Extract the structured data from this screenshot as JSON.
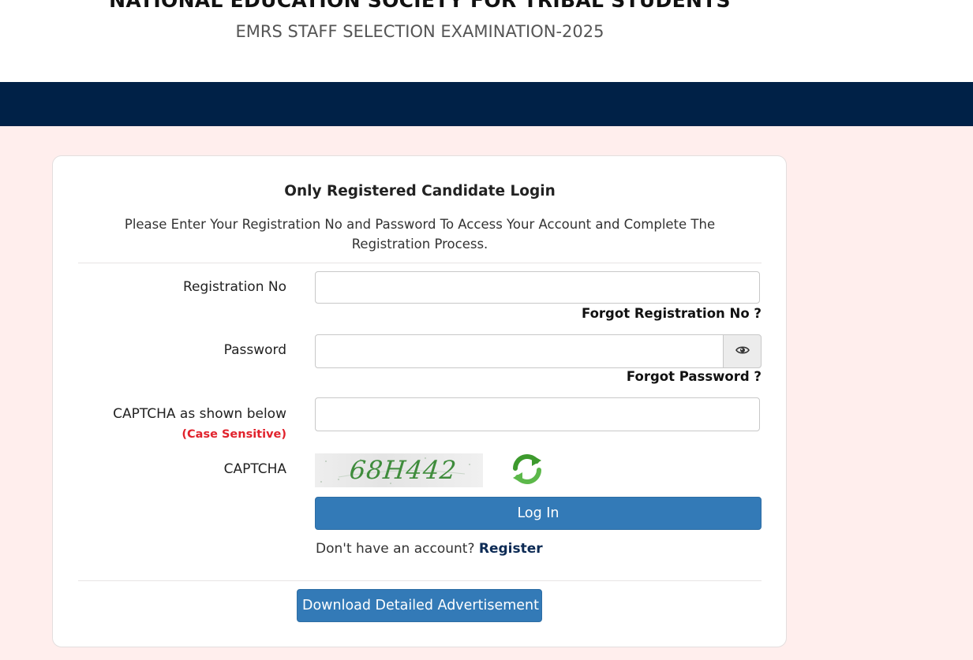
{
  "header": {
    "org_name": "NATIONAL EDUCATION SOCIETY FOR TRIBAL STUDENTS",
    "exam_name": "EMRS STAFF SELECTION EXAMINATION-2025"
  },
  "login": {
    "title": "Only Registered Candidate Login",
    "description": "Please Enter Your Registration No and Password To Access Your Account and Complete The Registration Process.",
    "registration_label": "Registration No",
    "registration_value": "",
    "forgot_registration": "Forgot Registration No ?",
    "password_label": "Password",
    "password_value": "",
    "forgot_password": "Forgot Password ?",
    "captcha_input_label": "CAPTCHA as shown below",
    "captcha_case_note": "(Case Sensitive)",
    "captcha_input_value": "",
    "captcha_label": "CAPTCHA",
    "captcha_code": "68H442",
    "login_button": "Log In",
    "no_account_text": "Don't have an account?",
    "register_link": "Register",
    "download_button": "Download Detailed Advertisement"
  },
  "icons": {
    "password_toggle": "eye-icon",
    "captcha_refresh": "refresh-icon"
  },
  "colors": {
    "navbar": "#002147",
    "page_background": "#ffeeed",
    "primary_button": "#337ab7",
    "case_note": "#e1222c",
    "captcha_text": "#3f8c3c"
  }
}
